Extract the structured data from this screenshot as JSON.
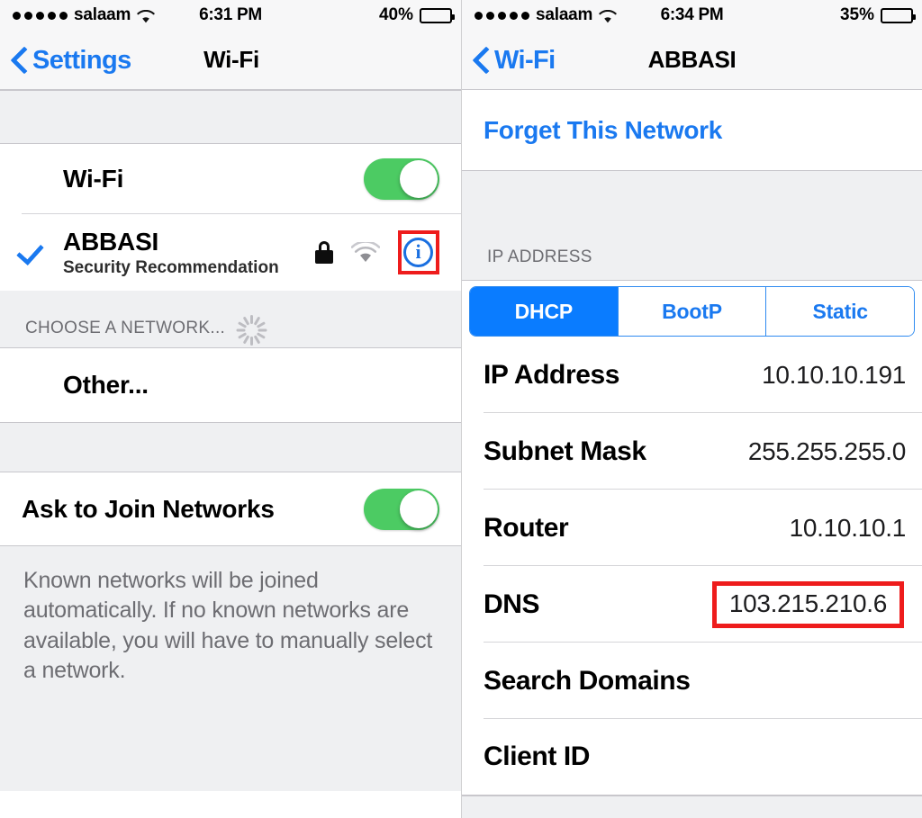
{
  "left": {
    "status_bar": {
      "signal_dots": 5,
      "carrier": "salaam",
      "wifi_icon": "wifi-icon",
      "time": "6:31 PM",
      "battery_percent": "40%",
      "battery_level": 40
    },
    "nav": {
      "back_label": "Settings",
      "back_icon": "chevron-left-icon",
      "title": "Wi-Fi"
    },
    "wifi_row": {
      "label": "Wi-Fi",
      "toggle_state": "on"
    },
    "connected_network": {
      "check_icon": "checkmark-icon",
      "name": "ABBASI",
      "subtitle": "Security Recommendation",
      "lock_icon": "lock-icon",
      "signal_icon": "wifi-signal-icon",
      "info_icon": "info-circle-icon",
      "highlighted": true
    },
    "choose_header": {
      "label": "CHOOSE A NETWORK...",
      "spinner_icon": "loading-spinner-icon"
    },
    "other_row": {
      "label": "Other..."
    },
    "ask_to_join": {
      "label": "Ask to Join Networks",
      "toggle_state": "on"
    },
    "footnote": "Known networks will be joined automatically. If no known networks are available, you will have to manually select a network."
  },
  "right": {
    "status_bar": {
      "signal_dots": 5,
      "carrier": "salaam",
      "wifi_icon": "wifi-icon",
      "time": "6:34 PM",
      "battery_percent": "35%",
      "battery_level": 35
    },
    "nav": {
      "back_label": "Wi-Fi",
      "back_icon": "chevron-left-icon",
      "title": "ABBASI"
    },
    "forget_network": {
      "label": "Forget This Network"
    },
    "ip_section_header": "IP ADDRESS",
    "segmented": {
      "options": [
        "DHCP",
        "BootP",
        "Static"
      ],
      "selected": "DHCP"
    },
    "fields": [
      {
        "key": "IP Address",
        "value": "10.10.10.191",
        "highlighted": false
      },
      {
        "key": "Subnet Mask",
        "value": "255.255.255.0",
        "highlighted": false
      },
      {
        "key": "Router",
        "value": "10.10.10.1",
        "highlighted": false
      },
      {
        "key": "DNS",
        "value": "103.215.210.6",
        "highlighted": true
      },
      {
        "key": "Search Domains",
        "value": "",
        "highlighted": false
      },
      {
        "key": "Client ID",
        "value": "",
        "highlighted": false
      }
    ]
  },
  "colors": {
    "ios_blue": "#1a79f0",
    "segment_blue": "#0a7cff",
    "toggle_green": "#4ccb63",
    "highlight_red": "#ee1c1c",
    "group_gray": "#eff0f2",
    "separator": "#c8c7cc",
    "secondary_text": "#6d6d72"
  }
}
